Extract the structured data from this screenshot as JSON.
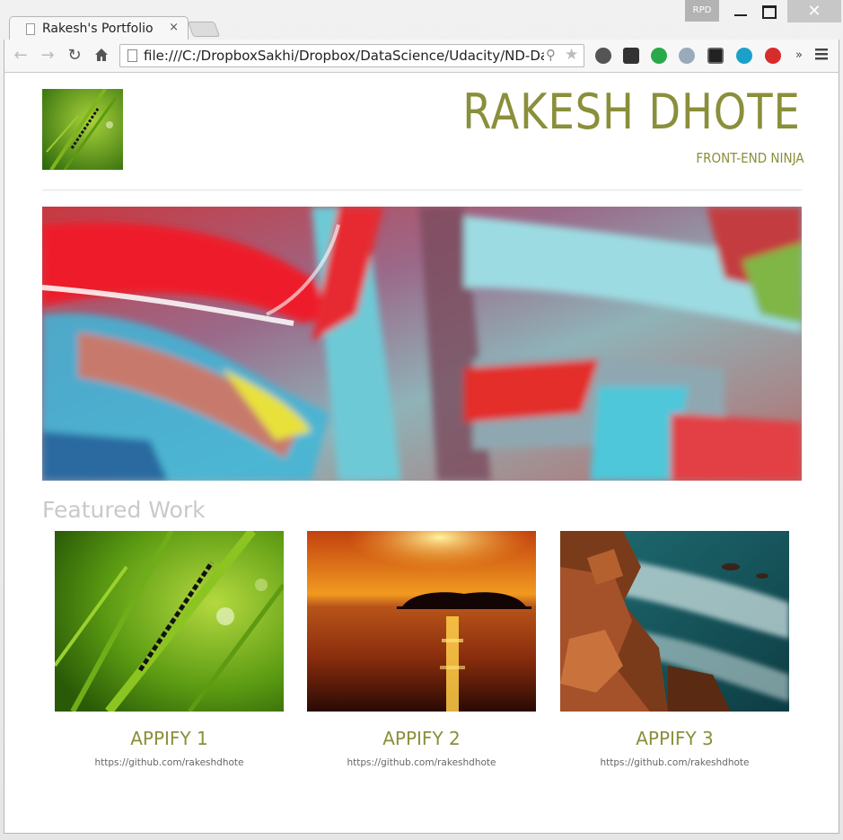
{
  "browser": {
    "tab_title": "Rakesh's Portfolio",
    "tab_close": "×",
    "profile_label": "RPD",
    "close_glyph": "✕",
    "url": "file:///C:/DropboxSakhi/Dropbox/DataScience/Udacity/ND-Data",
    "overflow_glyph": "»",
    "extensions": [
      "evernote-icon",
      "puzzle-icon",
      "grammarly-off-icon",
      "satellite-icon",
      "window-icon",
      "g-icon",
      "power-icon"
    ]
  },
  "site": {
    "title": "RAKESH DHOTE",
    "subtitle": "FRONT-END NINJA",
    "featured_heading": "Featured Work",
    "projects": [
      {
        "name": "APPIFY 1",
        "link": "https://github.com/rakeshdhote"
      },
      {
        "name": "APPIFY 2",
        "link": "https://github.com/rakeshdhote"
      },
      {
        "name": "APPIFY 3",
        "link": "https://github.com/rakeshdhote"
      }
    ]
  },
  "colors": {
    "accent": "#8a8f3a",
    "heading_gray": "#c9c9c9"
  }
}
